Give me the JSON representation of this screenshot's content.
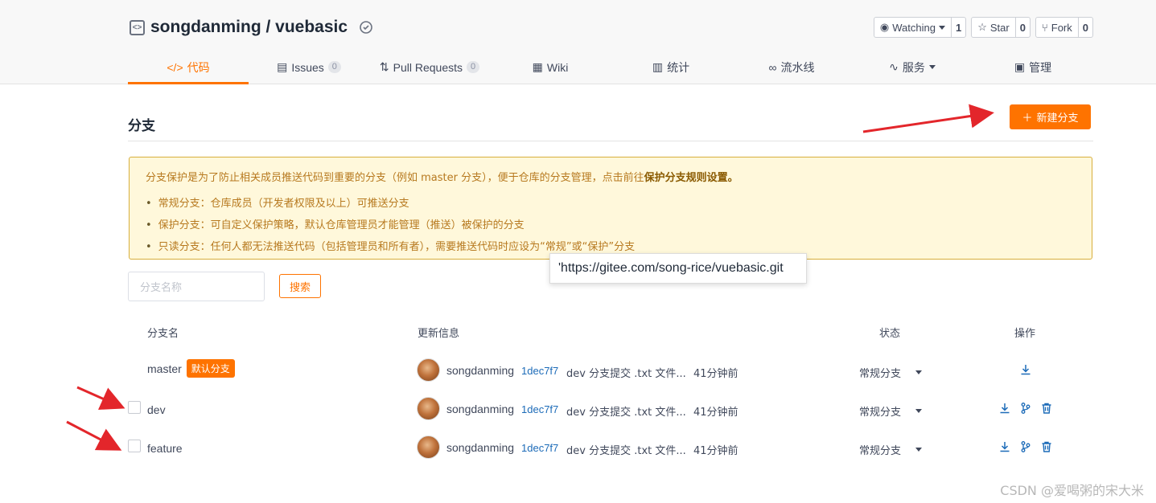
{
  "repo": {
    "title": "songdanming / vuebasic",
    "watching_label": "Watching",
    "watching_count": "1",
    "star_label": "Star",
    "star_count": "0",
    "fork_label": "Fork",
    "fork_count": "0"
  },
  "tabs": [
    {
      "label": "代码",
      "icon": "code-icon",
      "active": true
    },
    {
      "label": "Issues",
      "badge": "0",
      "icon": "issues-icon"
    },
    {
      "label": "Pull Requests",
      "badge": "0",
      "icon": "pull-request-icon"
    },
    {
      "label": "Wiki",
      "icon": "wiki-icon"
    },
    {
      "label": "统计",
      "icon": "stats-icon"
    },
    {
      "label": "流水线",
      "icon": "pipeline-icon"
    },
    {
      "label": "服务",
      "icon": "service-icon"
    },
    {
      "label": "管理",
      "icon": "manage-icon"
    }
  ],
  "page": {
    "title": "分支",
    "new_branch_label": "新建分支"
  },
  "notice": {
    "intro_prefix": "分支保护是为了防止相关成员推送代码到重要的分支（例如 master 分支），便于仓库的分支管理，点击前往",
    "intro_link": "保护分支规则设置。",
    "items": [
      "常规分支：仓库成员（开发者权限及以上）可推送分支",
      "保护分支：可自定义保护策略，默认仓库管理员才能管理（推送）被保护的分支",
      "只读分支：任何人都无法推送代码（包括管理员和所有者），需要推送代码时应设为“常规”或“保护”分支"
    ]
  },
  "tooltip": "'https://gitee.com/song-rice/vuebasic.git",
  "search": {
    "placeholder": "分支名称",
    "button": "搜索"
  },
  "table": {
    "headers": {
      "name": "分支名",
      "update": "更新信息",
      "status": "状态",
      "ops": "操作"
    },
    "rows": [
      {
        "name": "master",
        "tag": "默认分支",
        "author": "songdanming",
        "sha": "1dec7f7",
        "message": "dev 分支提交 .txt 文件...",
        "time": "41分钟前",
        "status": "常规分支"
      },
      {
        "name": "dev",
        "author": "songdanming",
        "sha": "1dec7f7",
        "message": "dev 分支提交 .txt 文件...",
        "time": "41分钟前",
        "status": "常规分支"
      },
      {
        "name": "feature",
        "author": "songdanming",
        "sha": "1dec7f7",
        "message": "dev 分支提交 .txt 文件...",
        "time": "41分钟前",
        "status": "常规分支"
      }
    ]
  },
  "watermark": "CSDN @爱喝粥的宋大米",
  "colors": {
    "accent": "#fe7300",
    "link": "#1c6bb8",
    "notice_bg": "#fff8db",
    "arrow": "#e3262b"
  }
}
